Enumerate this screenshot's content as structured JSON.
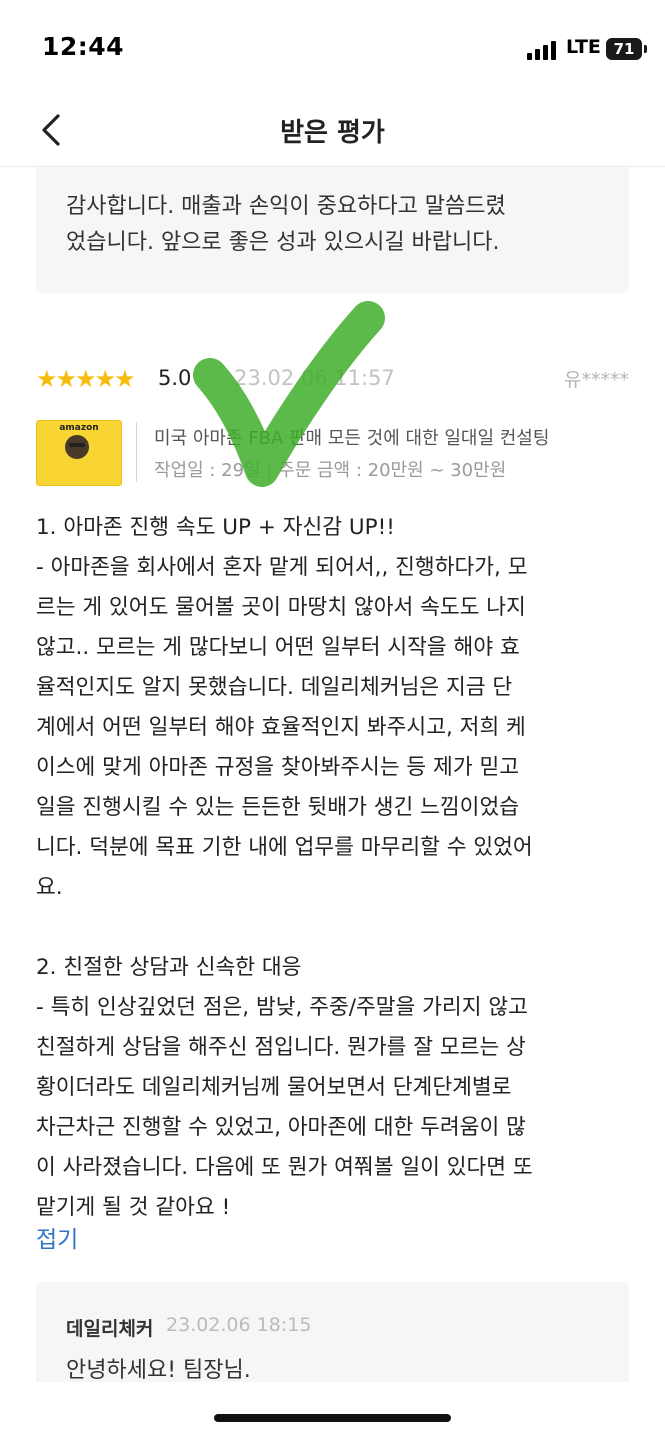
{
  "status_bar": {
    "time": "12:44",
    "network": "LTE",
    "battery": "71"
  },
  "nav": {
    "title": "받은 평가"
  },
  "prev_reply": {
    "text_lines": [
      "감사합니다. 매출과 손익이 중요하다고 말씀드렸",
      "었습니다. 앞으로 좋은 성과 있으시길 바랍니다."
    ]
  },
  "review": {
    "stars": "★★★★★",
    "score": "5.0",
    "date": "23.02.06 11:57",
    "username": "유*****",
    "product": {
      "thumb_title": "amazon",
      "title": "미국 아마존 FBA 판매 모든 것에 대한 일대일 컨설팅",
      "meta": "작업일 : 29일 | 주문 금액 : 20만원 ~ 30만원"
    },
    "lines": [
      "1. 아마존 진행 속도 UP + 자신감 UP!!",
      "- 아마존을 회사에서 혼자 맡게 되어서,, 진행하다가, 모",
      "르는 게 있어도 물어볼 곳이 마땅치 않아서 속도도 나지",
      "않고.. 모르는 게 많다보니 어떤 일부터 시작을 해야 효",
      "율적인지도 알지 못했습니다. 데일리체커님은 지금 단",
      "계에서 어떤 일부터 해야 효율적인지 봐주시고, 저희 케",
      "이스에 맞게 아마존 규정을 찾아봐주시는 등 제가 믿고",
      "일을 진행시킬 수 있는 든든한 뒷배가 생긴 느낌이었습",
      "니다. 덕분에 목표 기한 내에 업무를 마무리할 수 있었어",
      "요.",
      "",
      "2. 친절한 상담과 신속한 대응",
      "- 특히 인상깊었던 점은, 밤낮, 주중/주말을 가리지 않고",
      " 친절하게 상담을 해주신 점입니다. 뭔가를 잘 모르는 상",
      "황이더라도 데일리체커님께 물어보면서 단계단계별로",
      "차근차근 진행할 수 있었고, 아마존에 대한 두려움이 많",
      "이 사라졌습니다. 다음에 또 뭔가 여쭤볼 일이 있다면 또",
      " 맡기게 될 것 같아요 !"
    ],
    "fold_label": "접기"
  },
  "seller_reply": {
    "author": "데일리체커",
    "date": "23.02.06 18:15",
    "text": "안녕하세요! 팀장님."
  },
  "colors": {
    "star": "#f7bd0e",
    "link": "#2f73c7",
    "check": "#3fae2a"
  }
}
